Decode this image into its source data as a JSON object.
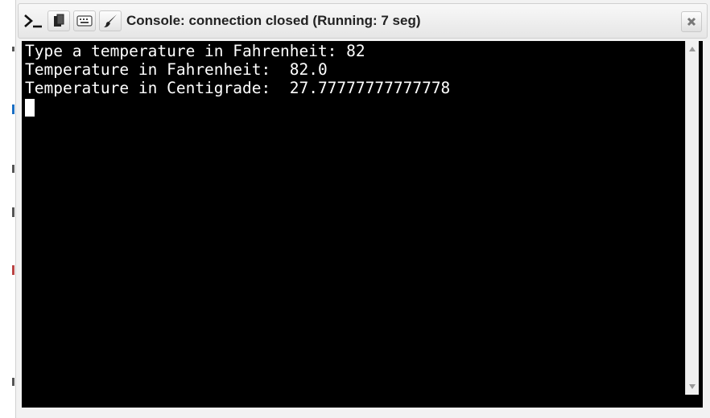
{
  "window": {
    "title": "Console: connection closed (Running: 7 seg)"
  },
  "toolbar": {
    "icons": [
      "terminal-icon",
      "clipboard-icon",
      "keyboard-icon",
      "brush-icon"
    ],
    "close_icon": "close-icon"
  },
  "console": {
    "lines": [
      "Type a temperature in Fahrenheit: 82",
      "Temperature in Fahrenheit:  82.0",
      "Temperature in Centigrade:  27.77777777777778"
    ]
  },
  "colors": {
    "console_bg": "#000000",
    "console_fg": "#ffffff"
  }
}
